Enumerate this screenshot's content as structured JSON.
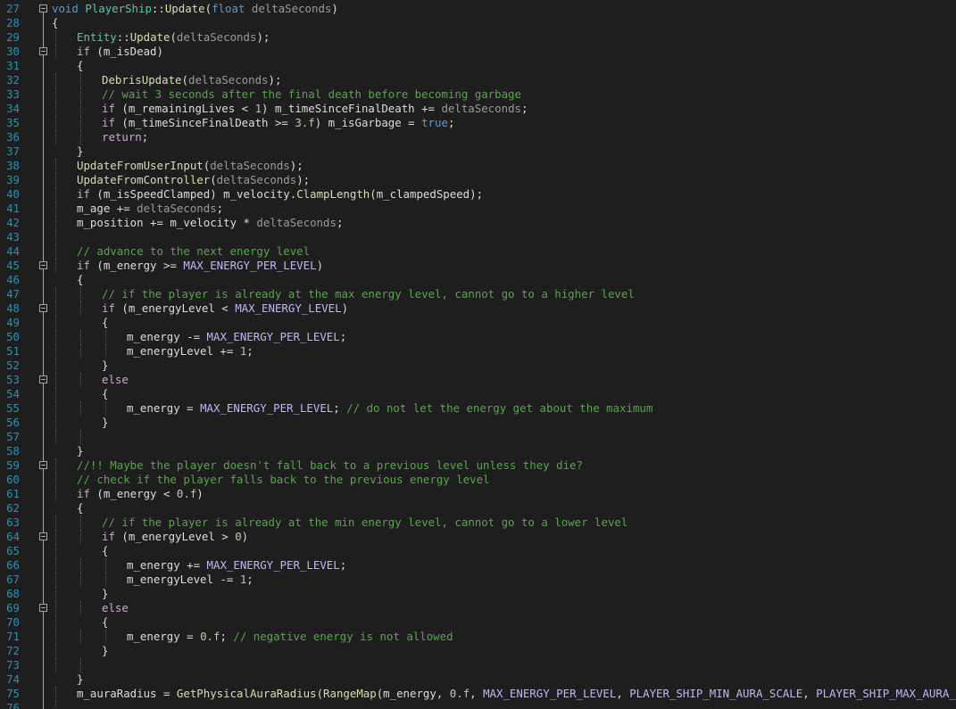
{
  "editor": {
    "language": "C++",
    "colors": {
      "background": "#1e1e1e",
      "line_number": "#2b91af",
      "keyword": "#569cd6",
      "control_keyword": "#d8a0df",
      "comment": "#57a64a",
      "function": "#dcdcaa",
      "type": "#4ec9b0",
      "macro": "#beb7ff",
      "parameter": "#9a9a9a",
      "number": "#b5cea8",
      "text": "#dcdcdc"
    },
    "lines": [
      {
        "n": "27",
        "fold": true,
        "indent": 0,
        "tokens": [
          [
            "kw",
            "void"
          ],
          [
            "tx",
            " "
          ],
          [
            "ty",
            "PlayerShip"
          ],
          [
            "tx",
            "::"
          ],
          [
            "fn",
            "Update"
          ],
          [
            "tx",
            "("
          ],
          [
            "kw",
            "float"
          ],
          [
            "tx",
            " "
          ],
          [
            "pa",
            "deltaSeconds"
          ],
          [
            "tx",
            ")"
          ]
        ]
      },
      {
        "n": "28",
        "fold": false,
        "indent": 0,
        "tokens": [
          [
            "tx",
            "{"
          ]
        ]
      },
      {
        "n": "29",
        "fold": false,
        "indent": 1,
        "tokens": [
          [
            "ty",
            "Entity"
          ],
          [
            "tx",
            "::"
          ],
          [
            "fn",
            "Update"
          ],
          [
            "tx",
            "("
          ],
          [
            "pa",
            "deltaSeconds"
          ],
          [
            "tx",
            ");"
          ]
        ]
      },
      {
        "n": "30",
        "fold": true,
        "indent": 1,
        "tokens": [
          [
            "kw2",
            "if"
          ],
          [
            "tx",
            " (m_isDead)"
          ]
        ]
      },
      {
        "n": "31",
        "fold": false,
        "indent": 1,
        "tokens": [
          [
            "tx",
            "{"
          ]
        ]
      },
      {
        "n": "32",
        "fold": false,
        "indent": 2,
        "tokens": [
          [
            "fn",
            "DebrisUpdate"
          ],
          [
            "tx",
            "("
          ],
          [
            "pa",
            "deltaSeconds"
          ],
          [
            "tx",
            ");"
          ]
        ]
      },
      {
        "n": "33",
        "fold": false,
        "indent": 2,
        "tokens": [
          [
            "cm",
            "// wait 3 seconds after the final death before becoming garbage"
          ]
        ]
      },
      {
        "n": "34",
        "fold": false,
        "indent": 2,
        "tokens": [
          [
            "kw2",
            "if"
          ],
          [
            "tx",
            " (m_remainingLives < "
          ],
          [
            "nu",
            "1"
          ],
          [
            "tx",
            ") m_timeSinceFinalDeath += "
          ],
          [
            "pa",
            "deltaSeconds"
          ],
          [
            "tx",
            ";"
          ]
        ]
      },
      {
        "n": "35",
        "fold": false,
        "indent": 2,
        "tokens": [
          [
            "kw2",
            "if"
          ],
          [
            "tx",
            " (m_timeSinceFinalDeath >= "
          ],
          [
            "nu",
            "3.f"
          ],
          [
            "tx",
            ") m_isGarbage = "
          ],
          [
            "kw",
            "true"
          ],
          [
            "tx",
            ";"
          ]
        ]
      },
      {
        "n": "36",
        "fold": false,
        "indent": 2,
        "tokens": [
          [
            "kw2",
            "return"
          ],
          [
            "tx",
            ";"
          ]
        ]
      },
      {
        "n": "37",
        "fold": false,
        "indent": 1,
        "tokens": [
          [
            "tx",
            "}"
          ]
        ]
      },
      {
        "n": "38",
        "fold": false,
        "indent": 1,
        "tokens": [
          [
            "fn",
            "UpdateFromUserInput"
          ],
          [
            "tx",
            "("
          ],
          [
            "pa",
            "deltaSeconds"
          ],
          [
            "tx",
            ");"
          ]
        ]
      },
      {
        "n": "39",
        "fold": false,
        "indent": 1,
        "tokens": [
          [
            "fn",
            "UpdateFromController"
          ],
          [
            "tx",
            "("
          ],
          [
            "pa",
            "deltaSeconds"
          ],
          [
            "tx",
            ");"
          ]
        ]
      },
      {
        "n": "40",
        "fold": false,
        "indent": 1,
        "tokens": [
          [
            "kw2",
            "if"
          ],
          [
            "tx",
            " (m_isSpeedClamped) m_velocity."
          ],
          [
            "fn",
            "ClampLength"
          ],
          [
            "tx",
            "(m_clampedSpeed);"
          ]
        ]
      },
      {
        "n": "41",
        "fold": false,
        "indent": 1,
        "tokens": [
          [
            "tx",
            "m_age += "
          ],
          [
            "pa",
            "deltaSeconds"
          ],
          [
            "tx",
            ";"
          ]
        ]
      },
      {
        "n": "42",
        "fold": false,
        "indent": 1,
        "tokens": [
          [
            "tx",
            "m_position += m_velocity * "
          ],
          [
            "pa",
            "deltaSeconds"
          ],
          [
            "tx",
            ";"
          ]
        ]
      },
      {
        "n": "43",
        "fold": false,
        "indent": 1,
        "tokens": []
      },
      {
        "n": "44",
        "fold": false,
        "indent": 1,
        "tokens": [
          [
            "cm",
            "// advance to the next energy level"
          ]
        ]
      },
      {
        "n": "45",
        "fold": true,
        "indent": 1,
        "tokens": [
          [
            "kw2",
            "if"
          ],
          [
            "tx",
            " (m_energy >= "
          ],
          [
            "mac",
            "MAX_ENERGY_PER_LEVEL"
          ],
          [
            "tx",
            ")"
          ]
        ]
      },
      {
        "n": "46",
        "fold": false,
        "indent": 1,
        "tokens": [
          [
            "tx",
            "{"
          ]
        ]
      },
      {
        "n": "47",
        "fold": false,
        "indent": 2,
        "tokens": [
          [
            "cm",
            "// if the player is already at the max energy level, cannot go to a higher level"
          ]
        ]
      },
      {
        "n": "48",
        "fold": true,
        "indent": 2,
        "tokens": [
          [
            "kw2",
            "if"
          ],
          [
            "tx",
            " (m_energyLevel < "
          ],
          [
            "mac",
            "MAX_ENERGY_LEVEL"
          ],
          [
            "tx",
            ")"
          ]
        ]
      },
      {
        "n": "49",
        "fold": false,
        "indent": 2,
        "tokens": [
          [
            "tx",
            "{"
          ]
        ]
      },
      {
        "n": "50",
        "fold": false,
        "indent": 3,
        "tokens": [
          [
            "tx",
            "m_energy -= "
          ],
          [
            "mac",
            "MAX_ENERGY_PER_LEVEL"
          ],
          [
            "tx",
            ";"
          ]
        ]
      },
      {
        "n": "51",
        "fold": false,
        "indent": 3,
        "tokens": [
          [
            "tx",
            "m_energyLevel += "
          ],
          [
            "nu",
            "1"
          ],
          [
            "tx",
            ";"
          ]
        ]
      },
      {
        "n": "52",
        "fold": false,
        "indent": 2,
        "tokens": [
          [
            "tx",
            "}"
          ]
        ]
      },
      {
        "n": "53",
        "fold": true,
        "indent": 2,
        "tokens": [
          [
            "kw2",
            "else"
          ]
        ]
      },
      {
        "n": "54",
        "fold": false,
        "indent": 2,
        "tokens": [
          [
            "tx",
            "{"
          ]
        ]
      },
      {
        "n": "55",
        "fold": false,
        "indent": 3,
        "tokens": [
          [
            "tx",
            "m_energy = "
          ],
          [
            "mac",
            "MAX_ENERGY_PER_LEVEL"
          ],
          [
            "tx",
            "; "
          ],
          [
            "cm",
            "// do not let the energy get about the maximum"
          ]
        ]
      },
      {
        "n": "56",
        "fold": false,
        "indent": 2,
        "tokens": [
          [
            "tx",
            "}"
          ]
        ]
      },
      {
        "n": "57",
        "fold": false,
        "indent": 2,
        "tokens": []
      },
      {
        "n": "58",
        "fold": false,
        "indent": 1,
        "tokens": [
          [
            "tx",
            "}"
          ]
        ]
      },
      {
        "n": "59",
        "fold": true,
        "indent": 1,
        "tokens": [
          [
            "cm",
            "//!! Maybe the player doesn't fall back to a previous level unless they die?"
          ]
        ]
      },
      {
        "n": "60",
        "fold": false,
        "indent": 1,
        "tokens": [
          [
            "cm",
            "// check if the player falls back to the previous energy level"
          ]
        ]
      },
      {
        "n": "61",
        "fold": false,
        "indent": 1,
        "tokens": [
          [
            "kw2",
            "if"
          ],
          [
            "tx",
            " (m_energy < "
          ],
          [
            "nu",
            "0.f"
          ],
          [
            "tx",
            ")"
          ]
        ]
      },
      {
        "n": "62",
        "fold": false,
        "indent": 1,
        "tokens": [
          [
            "tx",
            "{"
          ]
        ]
      },
      {
        "n": "63",
        "fold": false,
        "indent": 2,
        "tokens": [
          [
            "cm",
            "// if the player is already at the min energy level, cannot go to a lower level"
          ]
        ]
      },
      {
        "n": "64",
        "fold": true,
        "indent": 2,
        "tokens": [
          [
            "kw2",
            "if"
          ],
          [
            "tx",
            " (m_energyLevel > "
          ],
          [
            "nu",
            "0"
          ],
          [
            "tx",
            ")"
          ]
        ]
      },
      {
        "n": "65",
        "fold": false,
        "indent": 2,
        "tokens": [
          [
            "tx",
            "{"
          ]
        ]
      },
      {
        "n": "66",
        "fold": false,
        "indent": 3,
        "tokens": [
          [
            "tx",
            "m_energy += "
          ],
          [
            "mac",
            "MAX_ENERGY_PER_LEVEL"
          ],
          [
            "tx",
            ";"
          ]
        ]
      },
      {
        "n": "67",
        "fold": false,
        "indent": 3,
        "tokens": [
          [
            "tx",
            "m_energyLevel -= "
          ],
          [
            "nu",
            "1"
          ],
          [
            "tx",
            ";"
          ]
        ]
      },
      {
        "n": "68",
        "fold": false,
        "indent": 2,
        "tokens": [
          [
            "tx",
            "}"
          ]
        ]
      },
      {
        "n": "69",
        "fold": true,
        "indent": 2,
        "tokens": [
          [
            "kw2",
            "else"
          ]
        ]
      },
      {
        "n": "70",
        "fold": false,
        "indent": 2,
        "tokens": [
          [
            "tx",
            "{"
          ]
        ]
      },
      {
        "n": "71",
        "fold": false,
        "indent": 3,
        "tokens": [
          [
            "tx",
            "m_energy = "
          ],
          [
            "nu",
            "0.f"
          ],
          [
            "tx",
            "; "
          ],
          [
            "cm",
            "// negative energy is not allowed"
          ]
        ]
      },
      {
        "n": "72",
        "fold": false,
        "indent": 2,
        "tokens": [
          [
            "tx",
            "}"
          ]
        ]
      },
      {
        "n": "73",
        "fold": false,
        "indent": 2,
        "tokens": []
      },
      {
        "n": "74",
        "fold": false,
        "indent": 1,
        "tokens": [
          [
            "tx",
            "}"
          ]
        ]
      },
      {
        "n": "75",
        "fold": false,
        "indent": 1,
        "tokens": [
          [
            "tx",
            "m_auraRadius = "
          ],
          [
            "fn",
            "GetPhysicalAuraRadius"
          ],
          [
            "tx",
            "("
          ],
          [
            "fn",
            "RangeMap"
          ],
          [
            "tx",
            "(m_energy, "
          ],
          [
            "nu",
            "0.f"
          ],
          [
            "tx",
            ", "
          ],
          [
            "mac",
            "MAX_ENERGY_PER_LEVEL"
          ],
          [
            "tx",
            ", "
          ],
          [
            "mac",
            "PLAYER_SHIP_MIN_AURA_SCALE"
          ],
          [
            "tx",
            ", "
          ],
          [
            "mac",
            "PLAYER_SHIP_MAX_AURA_SCALE"
          ],
          [
            "tx",
            "));"
          ]
        ]
      },
      {
        "n": "76",
        "fold": false,
        "indent": 1,
        "tokens": []
      }
    ]
  }
}
